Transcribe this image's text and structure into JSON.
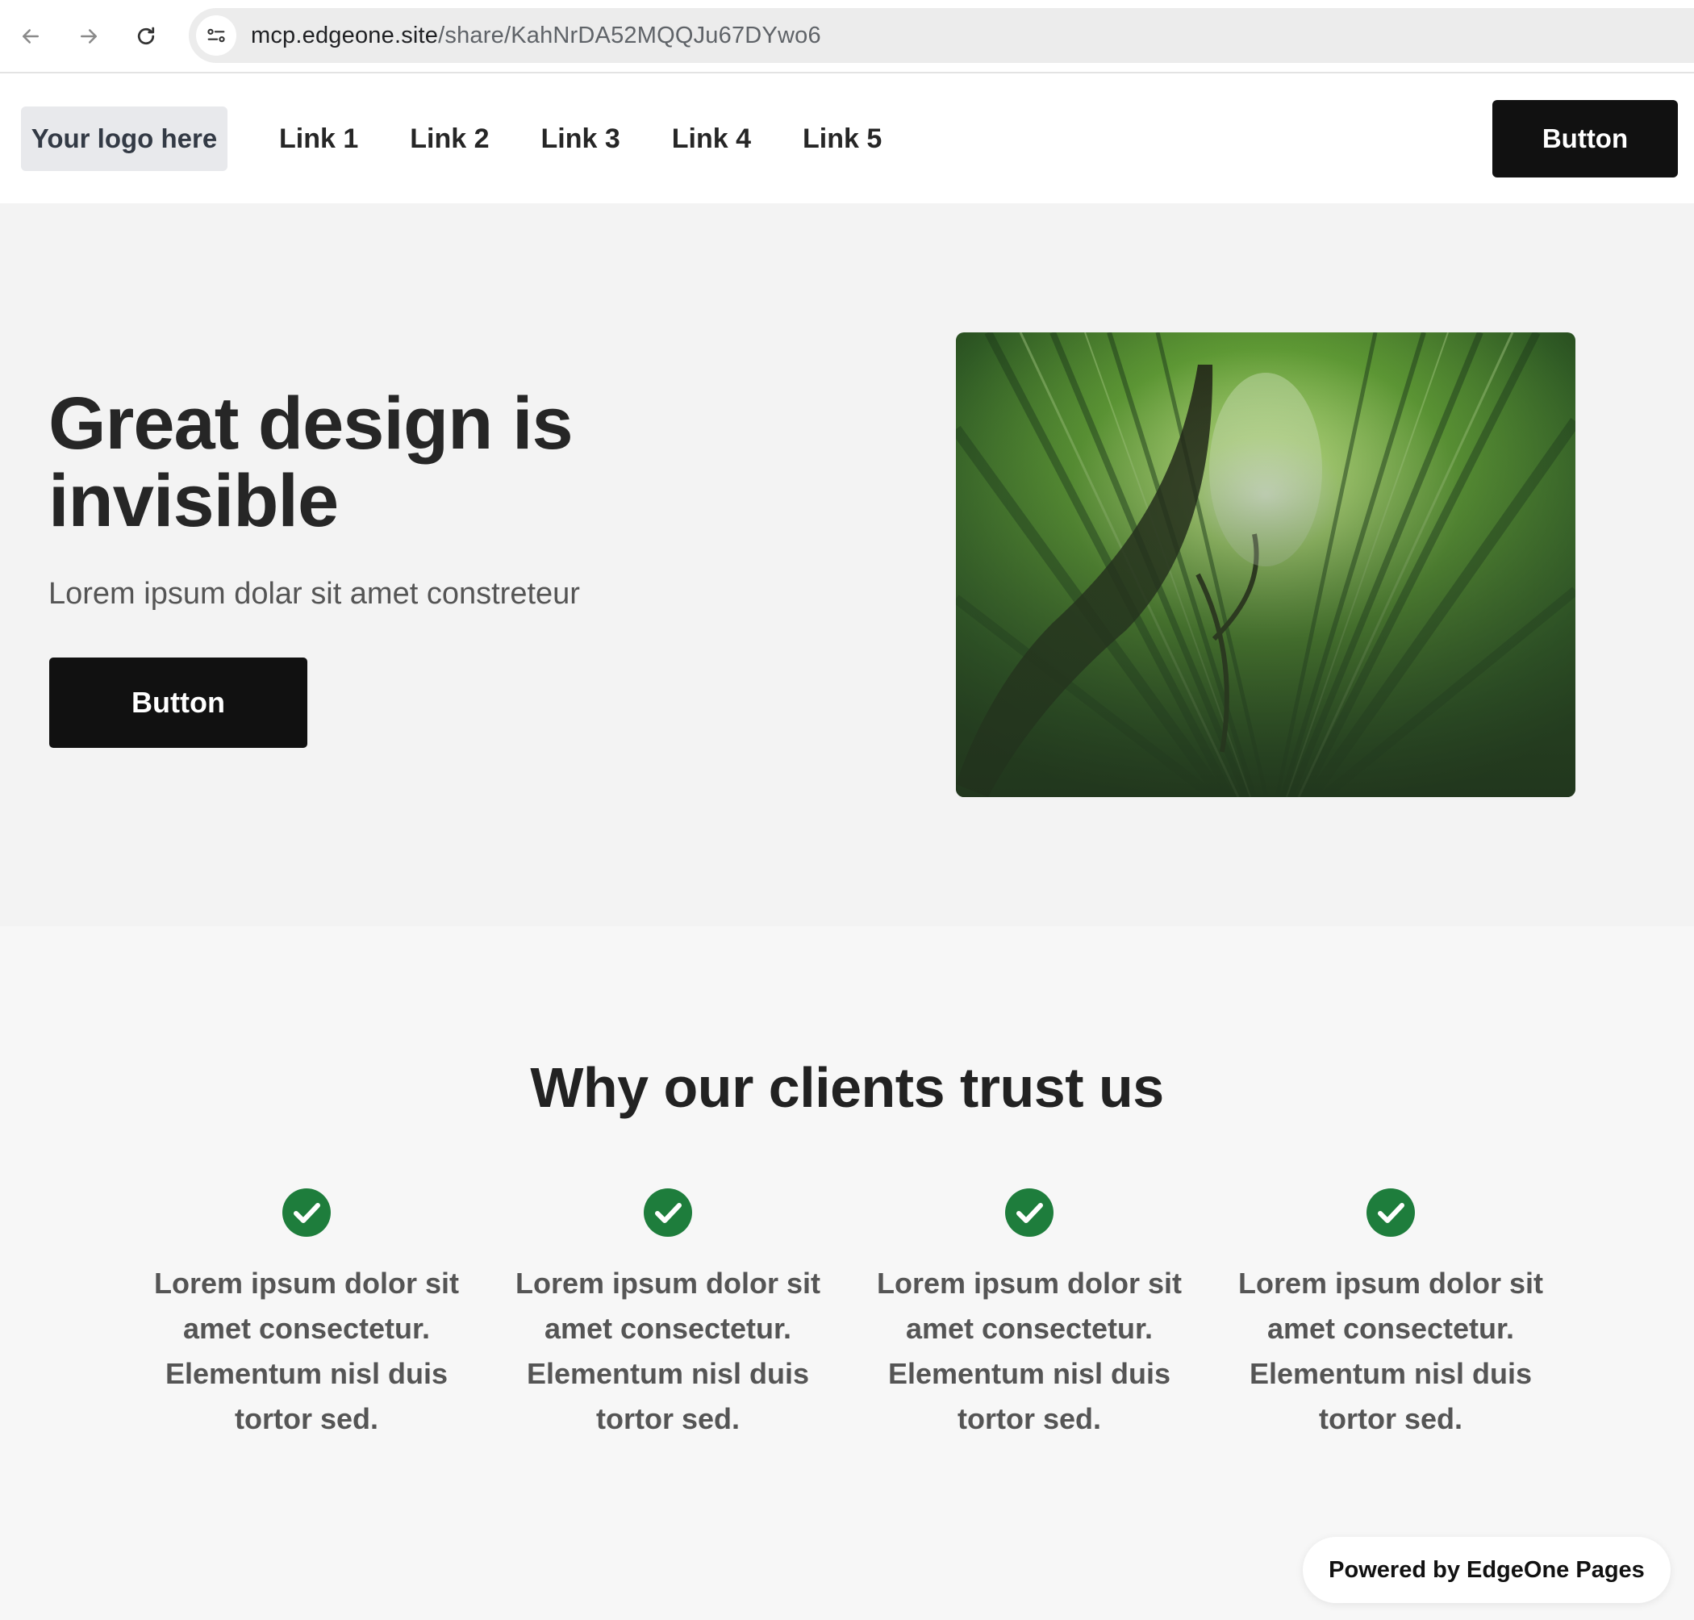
{
  "browser": {
    "url_host": "mcp.edgeone.site",
    "url_path": "/share/KahNrDA52MQQJu67DYwo6"
  },
  "header": {
    "logo_text": "Your logo here",
    "links": [
      "Link 1",
      "Link 2",
      "Link 3",
      "Link 4",
      "Link 5"
    ],
    "button_label": "Button"
  },
  "hero": {
    "title": "Great design is invisible",
    "subtitle": "Lorem ipsum dolar sit amet constreteur",
    "button_label": "Button"
  },
  "trust": {
    "title": "Why our clients trust us",
    "features": [
      "Lorem ipsum dolor sit amet consectetur. Elementum nisl duis tortor sed.",
      "Lorem ipsum dolor sit amet consectetur. Elementum nisl duis tortor sed.",
      "Lorem ipsum dolor sit amet consectetur. Elementum nisl duis tortor sed.",
      "Lorem ipsum dolor sit amet consectetur. Elementum nisl duis tortor sed."
    ]
  },
  "footer_badge": "Powered by EdgeOne Pages",
  "colors": {
    "check_green": "#1e7d3c",
    "button_black": "#111111"
  }
}
